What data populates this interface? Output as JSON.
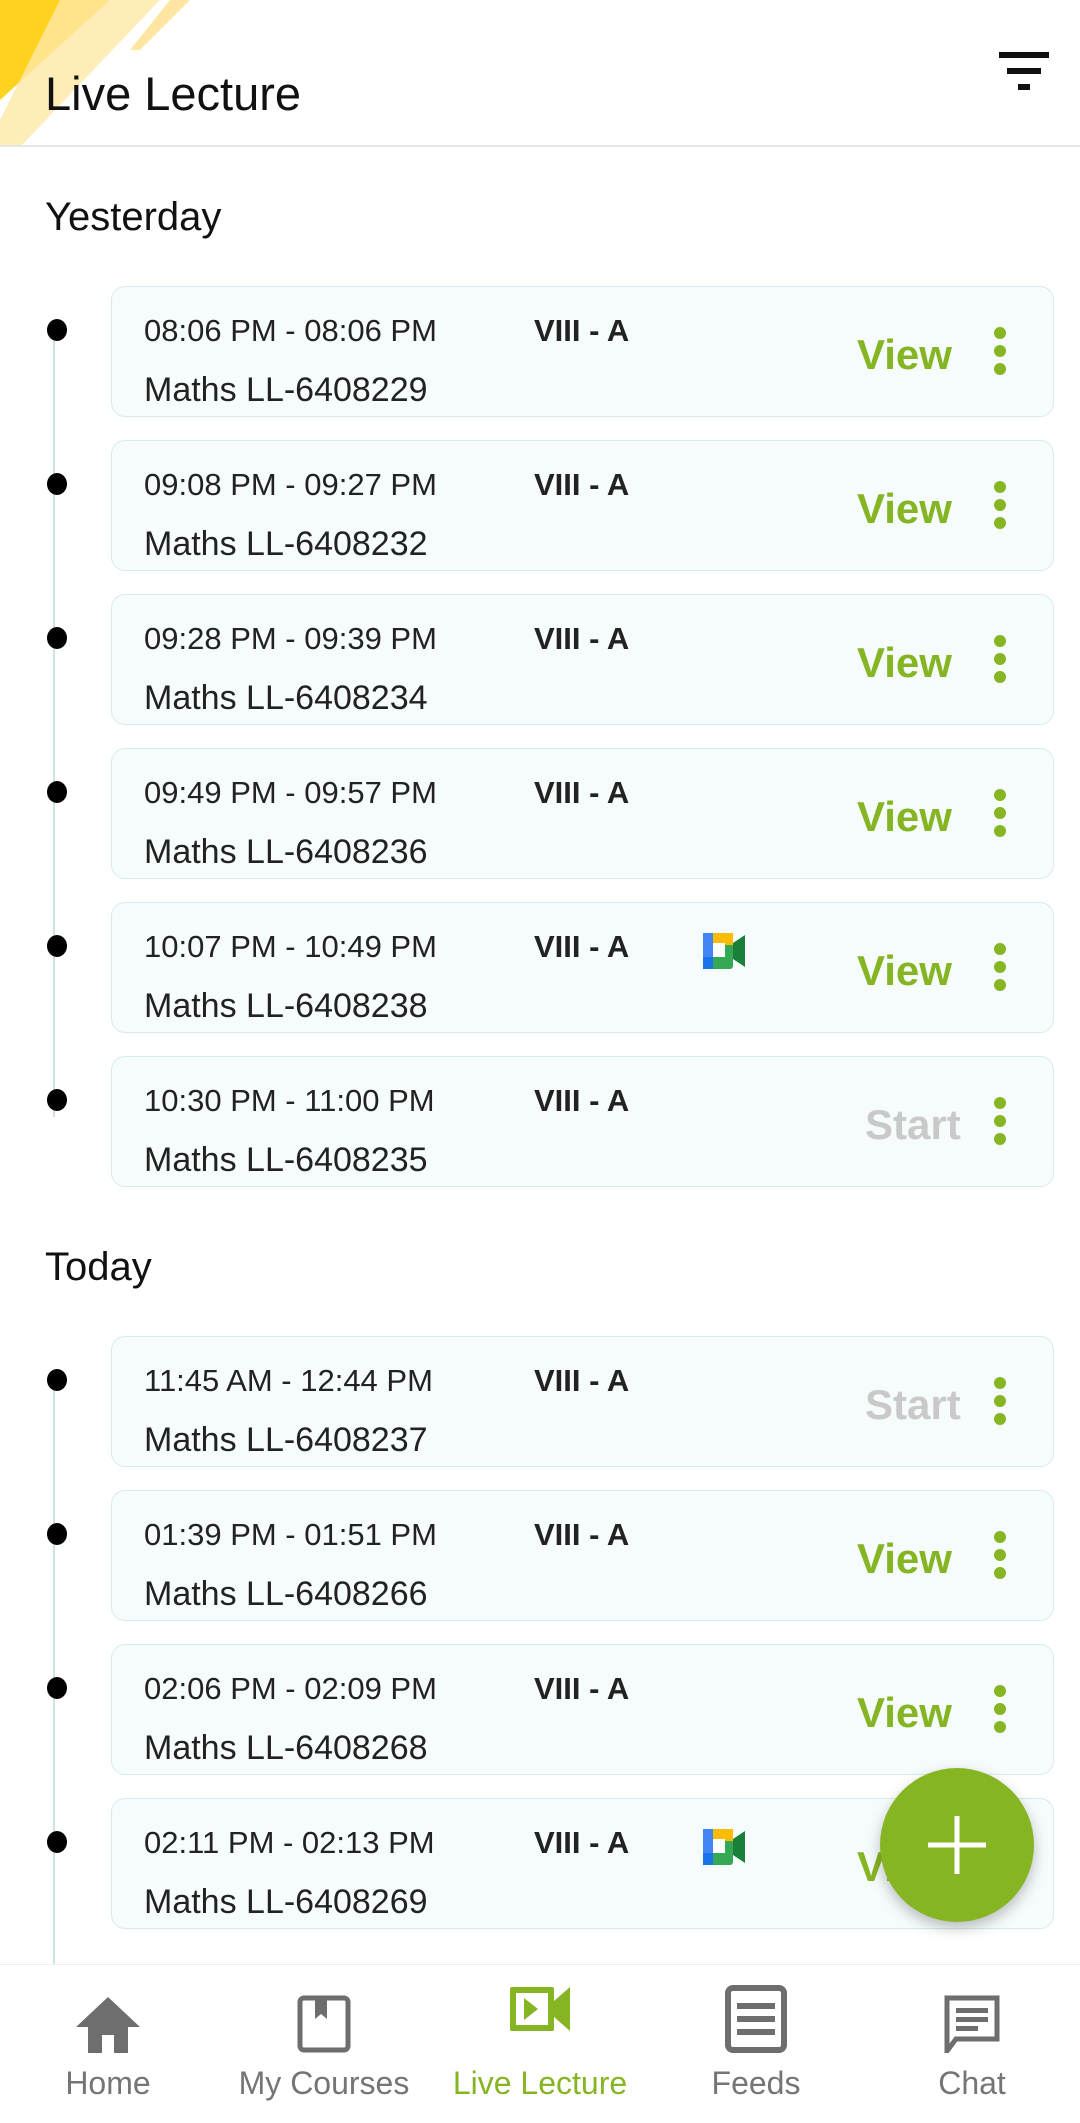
{
  "header": {
    "title": "Live Lecture",
    "filter_icon": "filter-icon"
  },
  "colors": {
    "accent": "#86b524",
    "start_disabled": "#c9c9c9"
  },
  "sections": [
    {
      "title": "Yesterday",
      "lectures": [
        {
          "time": "08:06 PM - 08:06 PM",
          "class": "VIII - A",
          "subject": "Maths LL-6408229",
          "action": "View",
          "meet": false
        },
        {
          "time": "09:08 PM - 09:27 PM",
          "class": "VIII - A",
          "subject": "Maths LL-6408232",
          "action": "View",
          "meet": false
        },
        {
          "time": "09:28 PM - 09:39 PM",
          "class": "VIII - A",
          "subject": "Maths LL-6408234",
          "action": "View",
          "meet": false
        },
        {
          "time": "09:49 PM - 09:57 PM",
          "class": "VIII - A",
          "subject": "Maths LL-6408236",
          "action": "View",
          "meet": false
        },
        {
          "time": "10:07 PM - 10:49 PM",
          "class": "VIII - A",
          "subject": "Maths LL-6408238",
          "action": "View",
          "meet": true
        },
        {
          "time": "10:30 PM - 11:00 PM",
          "class": "VIII - A",
          "subject": "Maths LL-6408235",
          "action": "Start",
          "meet": false
        }
      ]
    },
    {
      "title": "Today",
      "lectures": [
        {
          "time": "11:45 AM - 12:44 PM",
          "class": "VIII - A",
          "subject": "Maths LL-6408237",
          "action": "Start",
          "meet": false
        },
        {
          "time": "01:39 PM - 01:51 PM",
          "class": "VIII - A",
          "subject": "Maths LL-6408266",
          "action": "View",
          "meet": false
        },
        {
          "time": "02:06 PM - 02:09 PM",
          "class": "VIII - A",
          "subject": "Maths LL-6408268",
          "action": "View",
          "meet": false
        },
        {
          "time": "02:11 PM - 02:13 PM",
          "class": "VIII - A",
          "subject": "Maths LL-6408269",
          "action": "View",
          "meet": true
        }
      ]
    }
  ],
  "nav": {
    "items": [
      {
        "label": "Home",
        "icon": "home-icon"
      },
      {
        "label": "My Courses",
        "icon": "book-icon"
      },
      {
        "label": "Live Lecture",
        "icon": "video-icon",
        "active": true
      },
      {
        "label": "Feeds",
        "icon": "feeds-icon"
      },
      {
        "label": "Chat",
        "icon": "chat-icon"
      }
    ]
  }
}
